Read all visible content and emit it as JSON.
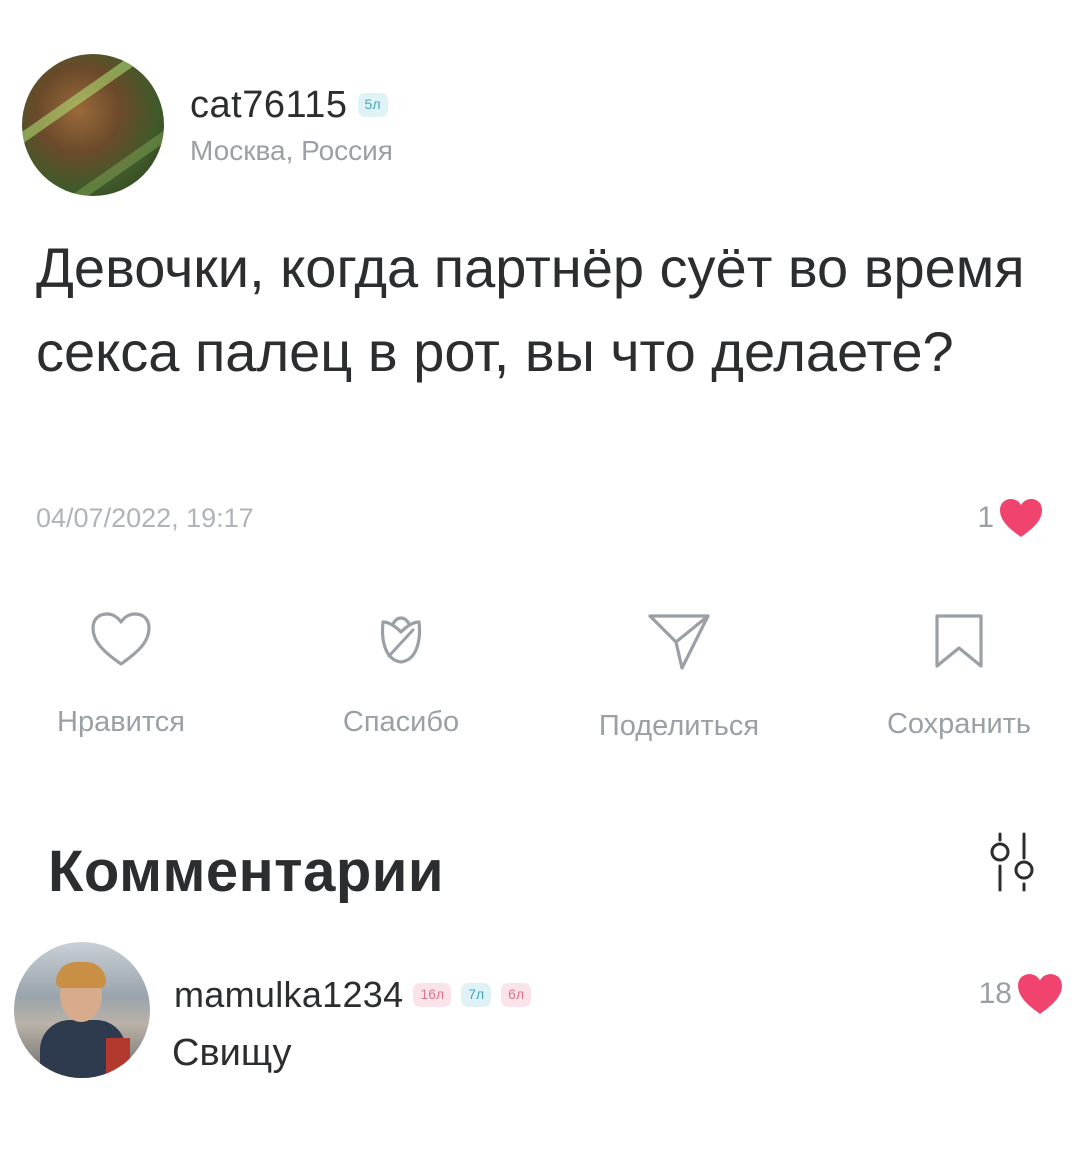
{
  "post": {
    "author": {
      "username": "cat76115",
      "badge": "5л",
      "location": "Москва, Россия"
    },
    "text": "Девочки, когда партнёр суёт во время секса палец в рот, вы что делаете?",
    "date": "04/07/2022, 19:17",
    "likes": "1"
  },
  "actions": [
    {
      "label": "Нравится",
      "icon": "heart-outline-icon"
    },
    {
      "label": "Спасибо",
      "icon": "tulip-icon"
    },
    {
      "label": "Поделиться",
      "icon": "send-icon"
    },
    {
      "label": "Сохранить",
      "icon": "bookmark-icon"
    }
  ],
  "comments_section": {
    "title": "Комментарии",
    "filter_icon": "sliders-icon"
  },
  "comments": [
    {
      "username": "mamulka1234",
      "badges": [
        "16л",
        "7л",
        "6л"
      ],
      "text": "Свищу",
      "likes": "18"
    }
  ],
  "colors": {
    "heart": "#f0446e",
    "muted": "#9aa0a6",
    "text": "#2c2d2e"
  }
}
